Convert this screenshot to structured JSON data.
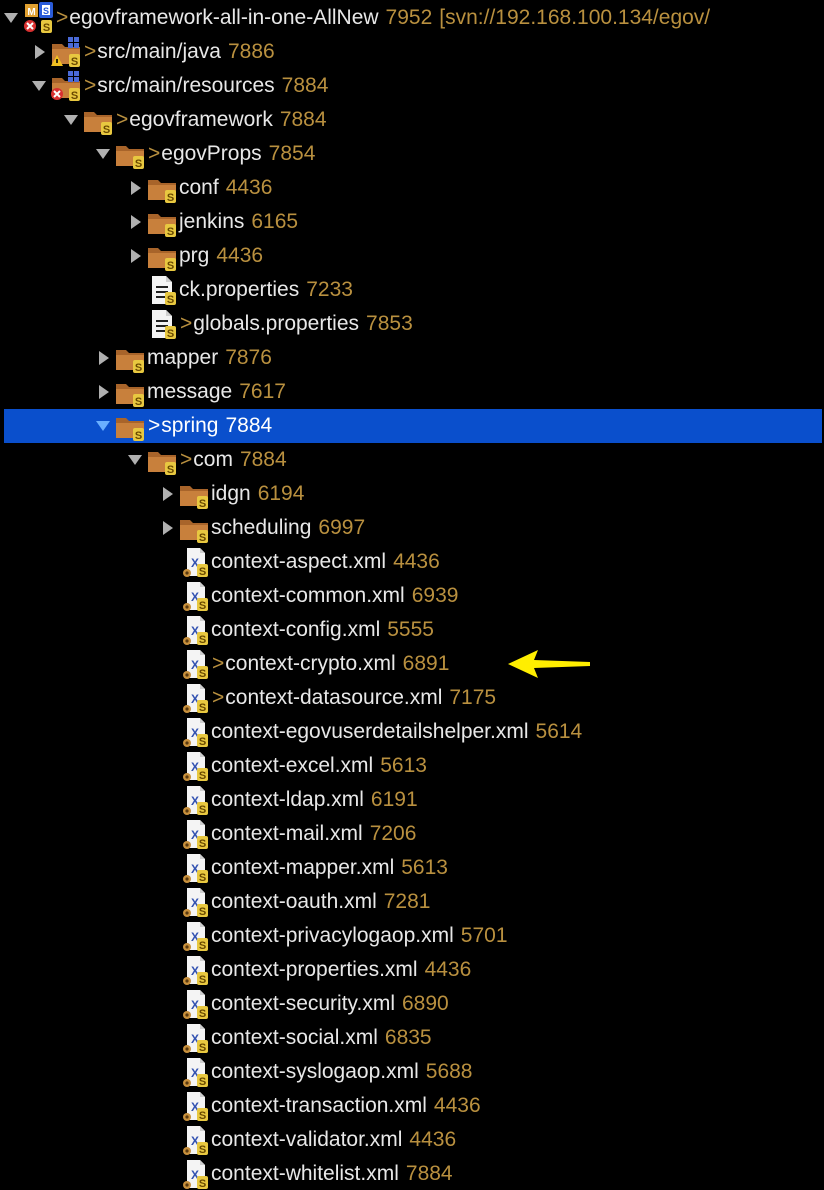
{
  "colors": {
    "background": "#000000",
    "text": "#e8e8e8",
    "revision": "#b9903f",
    "selection": "#0a4fcc",
    "folder": "#c8803c",
    "annotation_arrow": "#ffee00"
  },
  "tree": [
    {
      "label": "egovframework-all-in-one-AllNew",
      "rev": "7952",
      "suffix": "[svn://192.168.100.134/egov/",
      "dirty": true,
      "icon": "project-icon",
      "twisty": "down"
    },
    {
      "label": "src/main/java",
      "rev": "7886",
      "dirty": true,
      "icon": "source-folder-warning-icon",
      "twisty": "right"
    },
    {
      "label": "src/main/resources",
      "rev": "7884",
      "dirty": true,
      "icon": "source-folder-error-icon",
      "twisty": "down"
    },
    {
      "label": "egovframework",
      "rev": "7884",
      "dirty": true,
      "icon": "folder-icon",
      "twisty": "down"
    },
    {
      "label": "egovProps",
      "rev": "7854",
      "dirty": true,
      "icon": "folder-icon",
      "twisty": "down"
    },
    {
      "label": "conf",
      "rev": "4436",
      "dirty": false,
      "icon": "folder-icon",
      "twisty": "right"
    },
    {
      "label": "jenkins",
      "rev": "6165",
      "dirty": false,
      "icon": "folder-icon",
      "twisty": "right"
    },
    {
      "label": "prg",
      "rev": "4436",
      "dirty": false,
      "icon": "folder-icon",
      "twisty": "right"
    },
    {
      "label": "ck.properties",
      "rev": "7233",
      "dirty": false,
      "icon": "properties-file-icon",
      "twisty": "none"
    },
    {
      "label": "globals.properties",
      "rev": "7853",
      "dirty": true,
      "icon": "properties-file-icon",
      "twisty": "none"
    },
    {
      "label": "mapper",
      "rev": "7876",
      "dirty": false,
      "icon": "folder-icon",
      "twisty": "right"
    },
    {
      "label": "message",
      "rev": "7617",
      "dirty": false,
      "icon": "folder-icon",
      "twisty": "right"
    },
    {
      "label": "spring",
      "rev": "7884",
      "dirty": true,
      "icon": "folder-icon",
      "twisty": "down",
      "selected": true
    },
    {
      "label": "com",
      "rev": "7884",
      "dirty": true,
      "icon": "folder-icon",
      "twisty": "down"
    },
    {
      "label": "idgn",
      "rev": "6194",
      "dirty": false,
      "icon": "folder-icon",
      "twisty": "right"
    },
    {
      "label": "scheduling",
      "rev": "6997",
      "dirty": false,
      "icon": "folder-icon",
      "twisty": "right"
    },
    {
      "label": "context-aspect.xml",
      "rev": "4436",
      "dirty": false,
      "icon": "xml-file-icon",
      "twisty": "none"
    },
    {
      "label": "context-common.xml",
      "rev": "6939",
      "dirty": false,
      "icon": "xml-file-icon",
      "twisty": "none"
    },
    {
      "label": "context-config.xml",
      "rev": "5555",
      "dirty": false,
      "icon": "xml-file-icon",
      "twisty": "none"
    },
    {
      "label": "context-crypto.xml",
      "rev": "6891",
      "dirty": true,
      "icon": "xml-file-icon",
      "twisty": "none",
      "highlighted": true
    },
    {
      "label": "context-datasource.xml",
      "rev": "7175",
      "dirty": true,
      "icon": "xml-file-icon",
      "twisty": "none"
    },
    {
      "label": "context-egovuserdetailshelper.xml",
      "rev": "5614",
      "dirty": false,
      "icon": "xml-file-icon",
      "twisty": "none"
    },
    {
      "label": "context-excel.xml",
      "rev": "5613",
      "dirty": false,
      "icon": "xml-file-icon",
      "twisty": "none"
    },
    {
      "label": "context-ldap.xml",
      "rev": "6191",
      "dirty": false,
      "icon": "xml-file-icon",
      "twisty": "none"
    },
    {
      "label": "context-mail.xml",
      "rev": "7206",
      "dirty": false,
      "icon": "xml-file-icon",
      "twisty": "none"
    },
    {
      "label": "context-mapper.xml",
      "rev": "5613",
      "dirty": false,
      "icon": "xml-file-icon",
      "twisty": "none"
    },
    {
      "label": "context-oauth.xml",
      "rev": "7281",
      "dirty": false,
      "icon": "xml-file-icon",
      "twisty": "none"
    },
    {
      "label": "context-privacylogaop.xml",
      "rev": "5701",
      "dirty": false,
      "icon": "xml-file-icon",
      "twisty": "none"
    },
    {
      "label": "context-properties.xml",
      "rev": "4436",
      "dirty": false,
      "icon": "xml-file-icon",
      "twisty": "none"
    },
    {
      "label": "context-security.xml",
      "rev": "6890",
      "dirty": false,
      "icon": "xml-file-icon",
      "twisty": "none"
    },
    {
      "label": "context-social.xml",
      "rev": "6835",
      "dirty": false,
      "icon": "xml-file-icon",
      "twisty": "none"
    },
    {
      "label": "context-syslogaop.xml",
      "rev": "5688",
      "dirty": false,
      "icon": "xml-file-icon",
      "twisty": "none"
    },
    {
      "label": "context-transaction.xml",
      "rev": "4436",
      "dirty": false,
      "icon": "xml-file-icon",
      "twisty": "none"
    },
    {
      "label": "context-validator.xml",
      "rev": "4436",
      "dirty": false,
      "icon": "xml-file-icon",
      "twisty": "none"
    },
    {
      "label": "context-whitelist.xml",
      "rev": "7884",
      "dirty": false,
      "icon": "xml-file-icon",
      "twisty": "none"
    }
  ]
}
